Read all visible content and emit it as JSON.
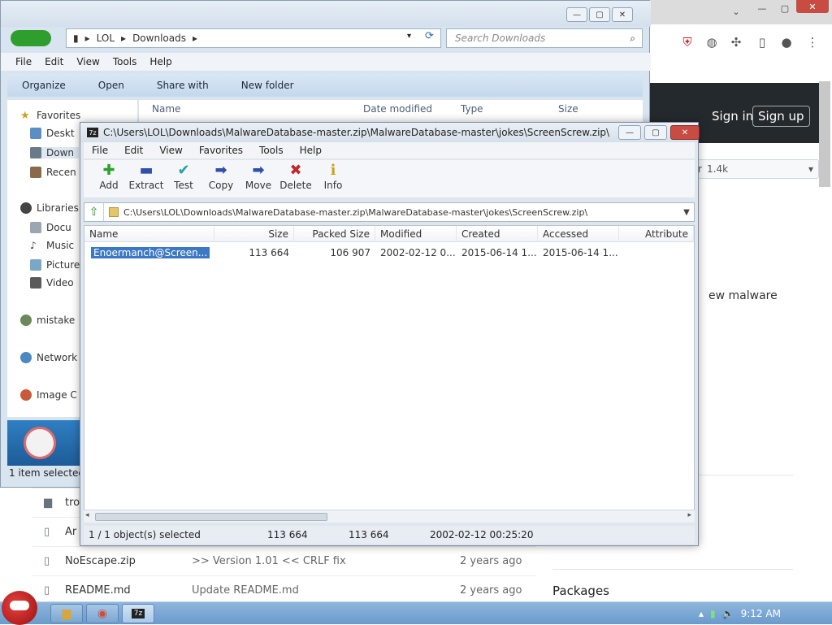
{
  "browser": {
    "github": {
      "sign_in": "Sign in",
      "sign_up": "Sign up"
    },
    "star": {
      "label": "tar",
      "count": "1.4k"
    },
    "about_fragment": "ew malware",
    "packages_label": "Packages",
    "repo_rows": [
      {
        "icon": "folder-icon",
        "name": "tro",
        "message": "",
        "age": ""
      },
      {
        "icon": "file-icon",
        "name": "Ar",
        "message": "",
        "age": ""
      },
      {
        "icon": "file-icon",
        "name": "NoEscape.zip",
        "message": ">> Version 1.01 << CRLF fix",
        "age": "2 years ago"
      },
      {
        "icon": "file-icon",
        "name": "README.md",
        "message": "Update README.md",
        "age": "2 years ago"
      }
    ]
  },
  "explorer": {
    "address": {
      "root": "LOL",
      "folder": "Downloads"
    },
    "search_placeholder": "Search Downloads",
    "menu": [
      "File",
      "Edit",
      "View",
      "Tools",
      "Help"
    ],
    "commands": [
      "Organize",
      "Open",
      "Share with",
      "New folder"
    ],
    "sidebar": [
      {
        "label": "Favorites",
        "icon": "star-icon"
      },
      {
        "label": "Deskt",
        "icon": "desktop-icon"
      },
      {
        "label": "Down",
        "icon": "downloads-icon"
      },
      {
        "label": "Recen",
        "icon": "recent-icon"
      },
      {
        "label": "Libraries",
        "icon": "library-icon"
      },
      {
        "label": "Docu",
        "icon": "documents-icon"
      },
      {
        "label": "Music",
        "icon": "music-icon"
      },
      {
        "label": "Picture",
        "icon": "pictures-icon"
      },
      {
        "label": "Video",
        "icon": "videos-icon"
      },
      {
        "label": "mistake",
        "icon": "homegroup-icon"
      },
      {
        "label": "Network",
        "icon": "network-icon"
      },
      {
        "label": "Image C",
        "icon": "image-icon"
      }
    ],
    "columns": [
      "Name",
      "Date modified",
      "Type",
      "Size"
    ],
    "status": "1 item selected"
  },
  "zip": {
    "title": "C:\\Users\\LOL\\Downloads\\MalwareDatabase-master.zip\\MalwareDatabase-master\\jokes\\ScreenScrew.zip\\",
    "menu": [
      "File",
      "Edit",
      "View",
      "Favorites",
      "Tools",
      "Help"
    ],
    "toolbar": [
      {
        "label": "Add",
        "icon": "add-icon",
        "glyph": "✚",
        "color": "#2ea02e"
      },
      {
        "label": "Extract",
        "icon": "extract-icon",
        "glyph": "▬",
        "color": "#2f4fa8"
      },
      {
        "label": "Test",
        "icon": "test-icon",
        "glyph": "✔",
        "color": "#22a0a0"
      },
      {
        "label": "Copy",
        "icon": "copy-icon",
        "glyph": "➡",
        "color": "#2f4fa8"
      },
      {
        "label": "Move",
        "icon": "move-icon",
        "glyph": "➡",
        "color": "#2f4fa8"
      },
      {
        "label": "Delete",
        "icon": "delete-icon",
        "glyph": "✖",
        "color": "#c0282a"
      },
      {
        "label": "Info",
        "icon": "info-icon",
        "glyph": "i",
        "color": "#c8a41a"
      }
    ],
    "path": "C:\\Users\\LOL\\Downloads\\MalwareDatabase-master.zip\\MalwareDatabase-master\\jokes\\ScreenScrew.zip\\",
    "columns": [
      "Name",
      "Size",
      "Packed Size",
      "Modified",
      "Created",
      "Accessed",
      "Attribute"
    ],
    "rows": [
      {
        "name": "Enoermanch@Screen...",
        "size": "113 664",
        "packed_size": "106 907",
        "modified": "2002-02-12 0...",
        "created": "2015-06-14 1...",
        "accessed": "2015-06-14 1...",
        "attributes": ""
      }
    ],
    "status": {
      "selection": "1 / 1 object(s) selected",
      "size": "113 664",
      "packed": "113 664",
      "modified": "2002-02-12 00:25:20"
    }
  },
  "taskbar": {
    "clock": "9:12 AM"
  }
}
